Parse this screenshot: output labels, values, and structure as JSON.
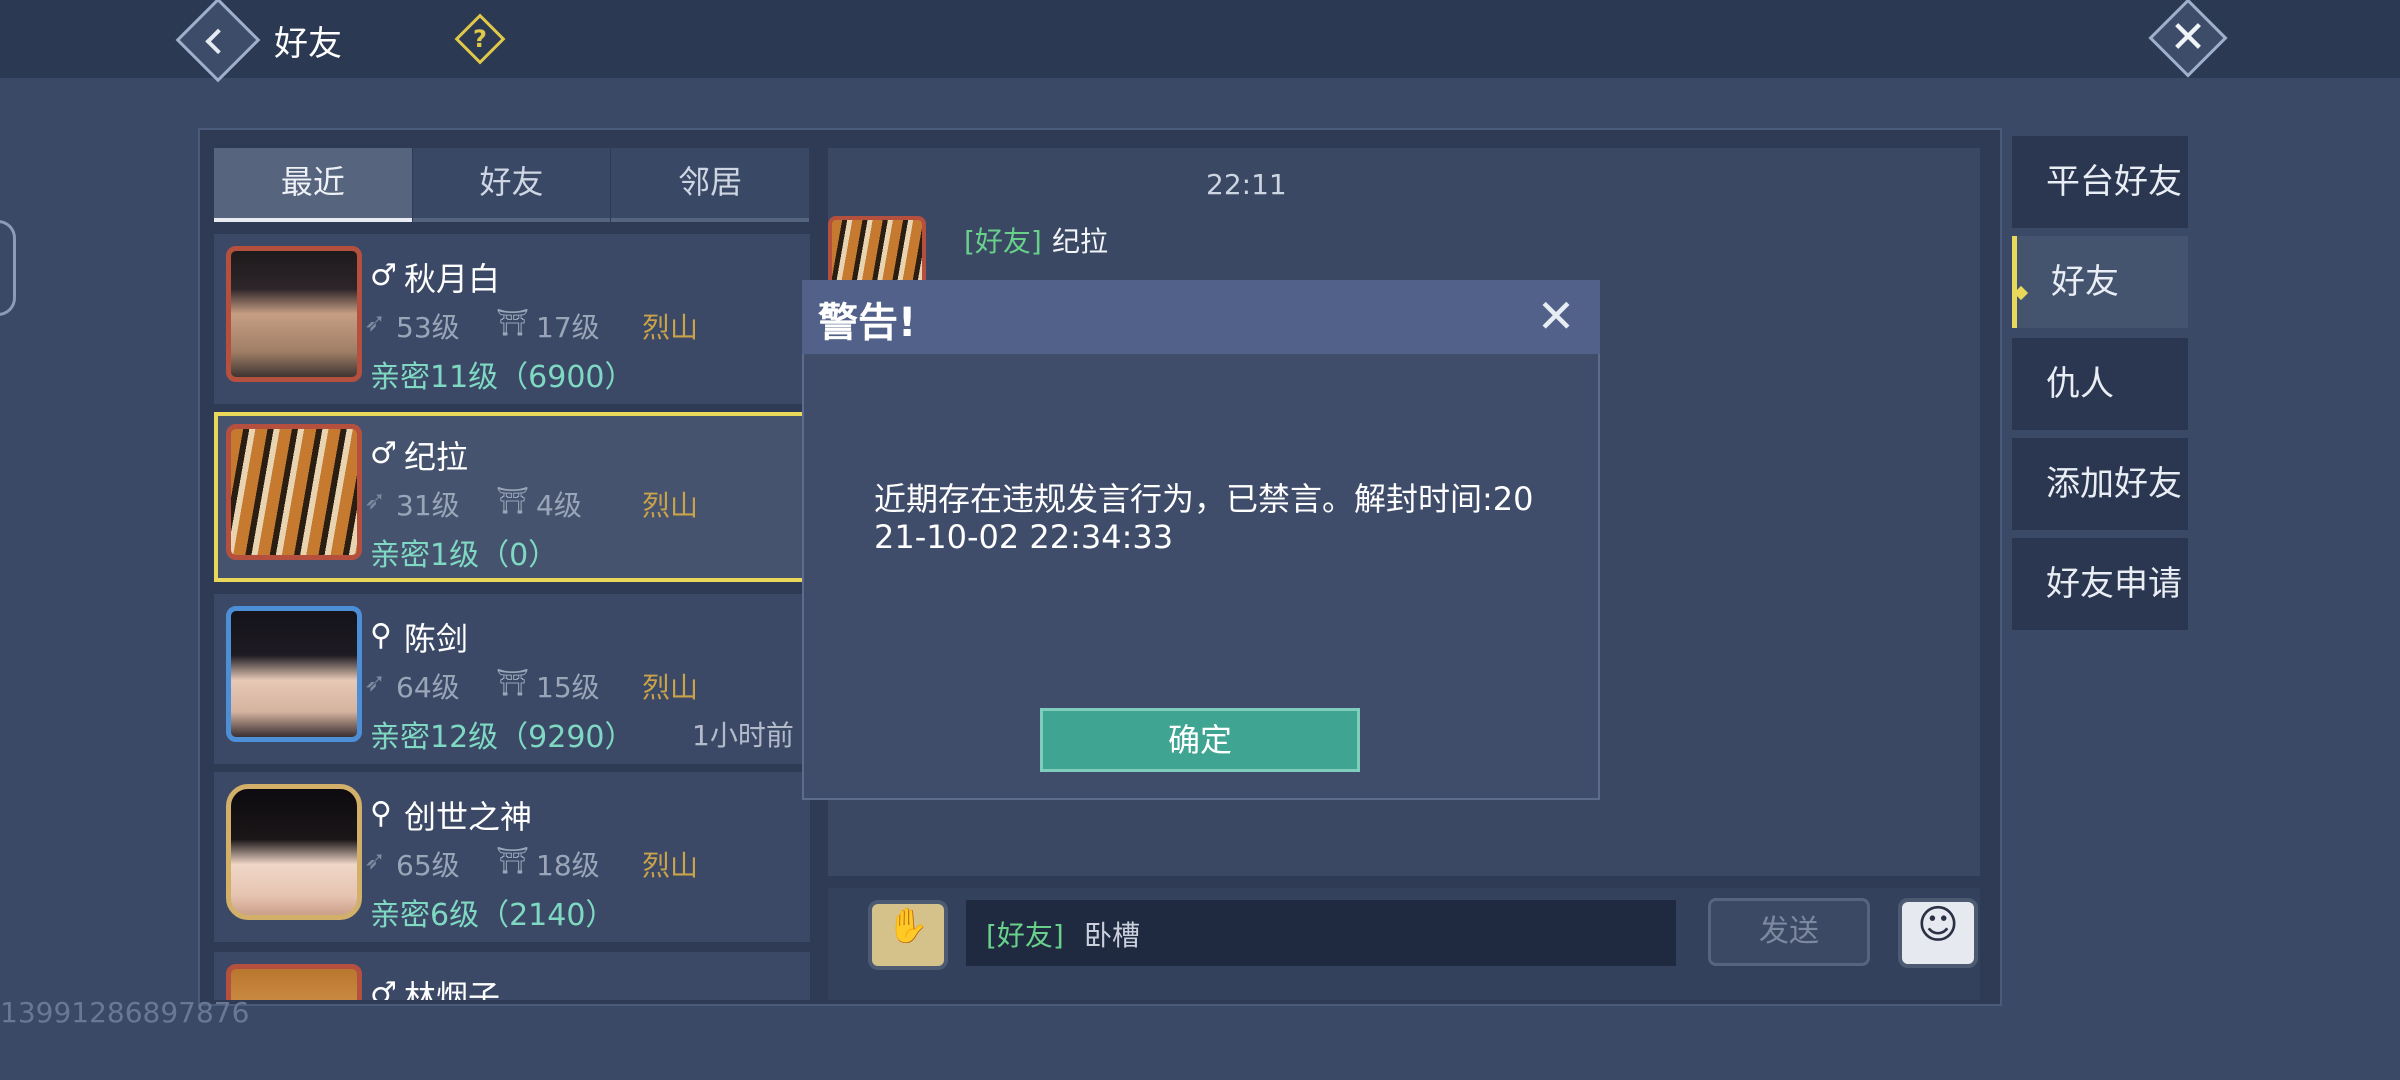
{
  "header": {
    "title": "好友",
    "help_glyph": "?",
    "close_glyph": "✕"
  },
  "tabs": [
    {
      "label": "最近",
      "active": true
    },
    {
      "label": "好友",
      "active": false
    },
    {
      "label": "邻居",
      "active": false
    }
  ],
  "friends": [
    {
      "gender": "♂",
      "name": "秋月白",
      "level": "53级",
      "guild_level": "17级",
      "guild": "烈山",
      "intimacy": "亲密11级（6900）",
      "ago": ""
    },
    {
      "gender": "♂",
      "name": "纪拉",
      "level": "31级",
      "guild_level": "4级",
      "guild": "烈山",
      "intimacy": "亲密1级（0）",
      "ago": "",
      "selected": true
    },
    {
      "gender": "⚲",
      "name": "陈剑",
      "level": "64级",
      "guild_level": "15级",
      "guild": "烈山",
      "intimacy": "亲密12级（9290）",
      "ago": "1小时前"
    },
    {
      "gender": "⚲",
      "name": "创世之神",
      "level": "65级",
      "guild_level": "18级",
      "guild": "烈山",
      "intimacy": "亲密6级（2140）",
      "ago": ""
    },
    {
      "gender": "♂",
      "name": "林烟子",
      "level": "",
      "guild_level": "",
      "guild": "",
      "intimacy": "",
      "ago": ""
    }
  ],
  "watermark": "13991286897876",
  "chat": {
    "time": "22:11",
    "sender_tag": "[好友]",
    "sender_name": "纪拉",
    "input_tag": "[好友]",
    "input_value": "卧槽",
    "send_label": "发送"
  },
  "right_menu": [
    {
      "label": "平台好友",
      "active": false
    },
    {
      "label": "好友",
      "active": true
    },
    {
      "label": "仇人",
      "active": false
    },
    {
      "label": "添加好友",
      "active": false
    },
    {
      "label": "好友申请",
      "active": false
    }
  ],
  "dialog": {
    "title": "警告!",
    "message": "近期存在违规发言行为，已禁言。解封时间:2021-10-02 22:34:33",
    "ok_label": "确定",
    "close_glyph": "✕"
  },
  "icons": {
    "back": "chevron-left-icon",
    "help": "question-icon",
    "close": "close-icon",
    "voice": "microphone-icon",
    "emoji": "smiley-icon"
  },
  "colors": {
    "accent_yellow": "#e9d85a",
    "intimacy_green": "#7fd9c2",
    "tag_green": "#68d08a",
    "guild_gold": "#c9a24a",
    "ok_teal": "#3fa491"
  }
}
